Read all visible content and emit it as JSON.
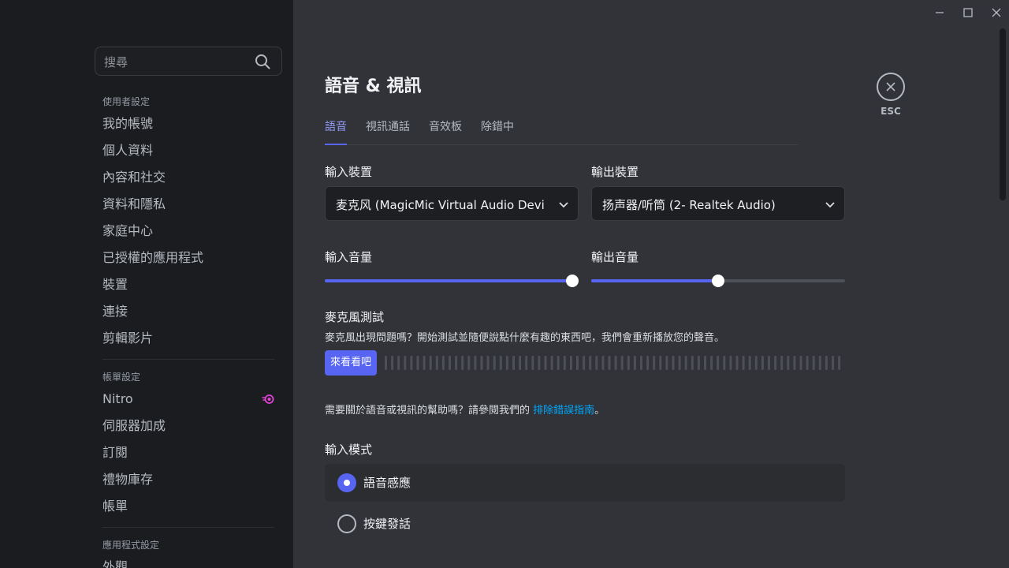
{
  "search": {
    "placeholder": "搜尋"
  },
  "sidebar": {
    "user_settings_header": "使用者設定",
    "user_items": [
      "我的帳號",
      "個人資料",
      "內容和社交",
      "資料和隱私",
      "家庭中心",
      "已授權的應用程式",
      "裝置",
      "連接",
      "剪輯影片"
    ],
    "billing_header": "帳單設定",
    "billing_items": [
      "Nitro",
      "伺服器加成",
      "訂閱",
      "禮物庫存",
      "帳單"
    ],
    "app_settings_header": "應用程式設定",
    "app_items_partial": "外觀"
  },
  "main": {
    "title": "語音 & 視訊",
    "tabs": [
      "語音",
      "視訊通話",
      "音效板",
      "除錯中"
    ],
    "input_device_label": "輸入裝置",
    "input_device_value": "麦克风 (MagicMic Virtual Audio Device)",
    "output_device_label": "輸出裝置",
    "output_device_value": "扬声器/听筒 (2- Realtek Audio)",
    "input_volume_label": "輸入音量",
    "output_volume_label": "輸出音量",
    "input_volume": 1.0,
    "output_volume": 0.5,
    "mic_test_label": "麥克風測試",
    "mic_test_desc": "麥克風出現問題嗎？開始測試並隨便說點什麼有趣的東西吧，我們會重新播放您的聲音。",
    "mic_test_button": "來看看吧",
    "help_prefix": "需要關於語音或視訊的幫助嗎？請參閱我們的 ",
    "help_link": "排除錯誤指南",
    "help_suffix": "。",
    "input_mode_label": "輸入模式",
    "input_modes": [
      "語音感應",
      "按鍵發話"
    ],
    "selected_input_mode": 0
  },
  "close": {
    "esc_label": "ESC"
  },
  "colors": {
    "accent": "#5865f2",
    "link": "#00a8fc",
    "sidebar_bg": "#1b1c1f",
    "content_bg": "#313338"
  }
}
